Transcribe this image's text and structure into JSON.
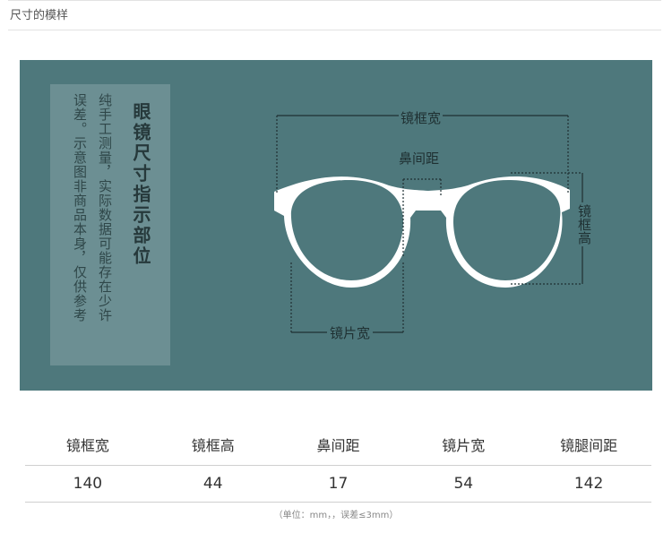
{
  "header": {
    "title": "尺寸的模样"
  },
  "panel": {
    "title": "眼镜尺寸指示部位",
    "note_col1": "纯手工测量，实际数据可能存在少许",
    "note_col2": "误差。示意图非商品本身，仅供参考",
    "frame_color": "#ffffff",
    "background_color": "#4e787c",
    "labels": {
      "frame_width": "镜框宽",
      "nose_bridge": "鼻间距",
      "lens_width": "镜片宽",
      "frame_height": "镜框高"
    }
  },
  "specs": {
    "headers": [
      "镜框宽",
      "镜框高",
      "鼻间距",
      "镜片宽",
      "镜腿间距"
    ],
    "values": [
      "140",
      "44",
      "17",
      "54",
      "142"
    ]
  },
  "footnote": "（单位：mm，，误差≤3mm）"
}
